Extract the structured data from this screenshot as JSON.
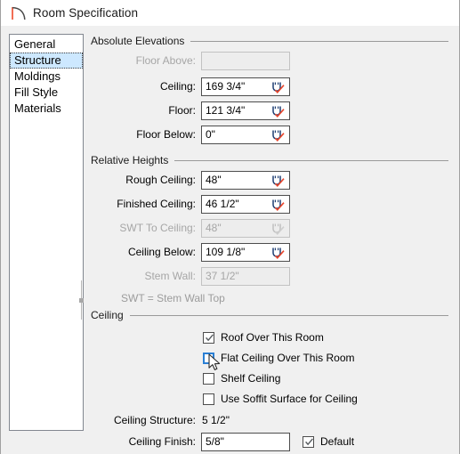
{
  "window": {
    "title": "Room Specification",
    "icon": "room-arc-icon"
  },
  "sidebar": {
    "items": [
      {
        "label": "General",
        "selected": false
      },
      {
        "label": "Structure",
        "selected": true
      },
      {
        "label": "Moldings",
        "selected": false
      },
      {
        "label": "Fill Style",
        "selected": false
      },
      {
        "label": "Materials",
        "selected": false
      }
    ]
  },
  "splitter": {
    "name": "panel-splitter"
  },
  "groups": {
    "absolute_elevations": {
      "title": "Absolute Elevations",
      "rows": [
        {
          "label": "Floor Above:",
          "value": "",
          "disabled": true,
          "spinner": false
        },
        {
          "label": "Ceiling:",
          "value": "169 3/4\"",
          "disabled": false,
          "spinner": true
        },
        {
          "label": "Floor:",
          "value": "121 3/4\"",
          "disabled": false,
          "spinner": true
        },
        {
          "label": "Floor Below:",
          "value": "0\"",
          "disabled": false,
          "spinner": true
        }
      ]
    },
    "relative_heights": {
      "title": "Relative Heights",
      "rows": [
        {
          "label": "Rough Ceiling:",
          "value": "48\"",
          "disabled": false,
          "spinner": true
        },
        {
          "label": "Finished Ceiling:",
          "value": "46 1/2\"",
          "disabled": false,
          "spinner": true
        },
        {
          "label": "SWT To Ceiling:",
          "value": "48\"",
          "disabled": true,
          "spinner": true
        },
        {
          "label": "Ceiling Below:",
          "value": "109 1/8\"",
          "disabled": false,
          "spinner": true
        },
        {
          "label": "Stem Wall:",
          "value": "37 1/2\"",
          "disabled": true,
          "spinner": false
        }
      ],
      "note": "SWT = Stem Wall Top"
    },
    "ceiling": {
      "title": "Ceiling",
      "checkboxes": [
        {
          "label": "Roof Over This Room",
          "checked": true,
          "hover": false
        },
        {
          "label": "Flat Ceiling Over This Room",
          "checked": false,
          "hover": true
        },
        {
          "label": "Shelf Ceiling",
          "checked": false,
          "hover": false
        },
        {
          "label": "Use Soffit Surface for Ceiling",
          "checked": false,
          "hover": false
        }
      ],
      "ceiling_structure_label": "Ceiling Structure:",
      "ceiling_structure_value": "5 1/2\"",
      "ceiling_finish_label": "Ceiling Finish:",
      "ceiling_finish_value": "5/8\"",
      "default_label": "Default",
      "default_checked": true
    }
  },
  "colors": {
    "selection": "#cde8ff",
    "hover_border": "#2a7fd4",
    "accent_red": "#e8442a",
    "icon_blue": "#1f3f73",
    "dialog_bg": "#f0f0f0"
  }
}
